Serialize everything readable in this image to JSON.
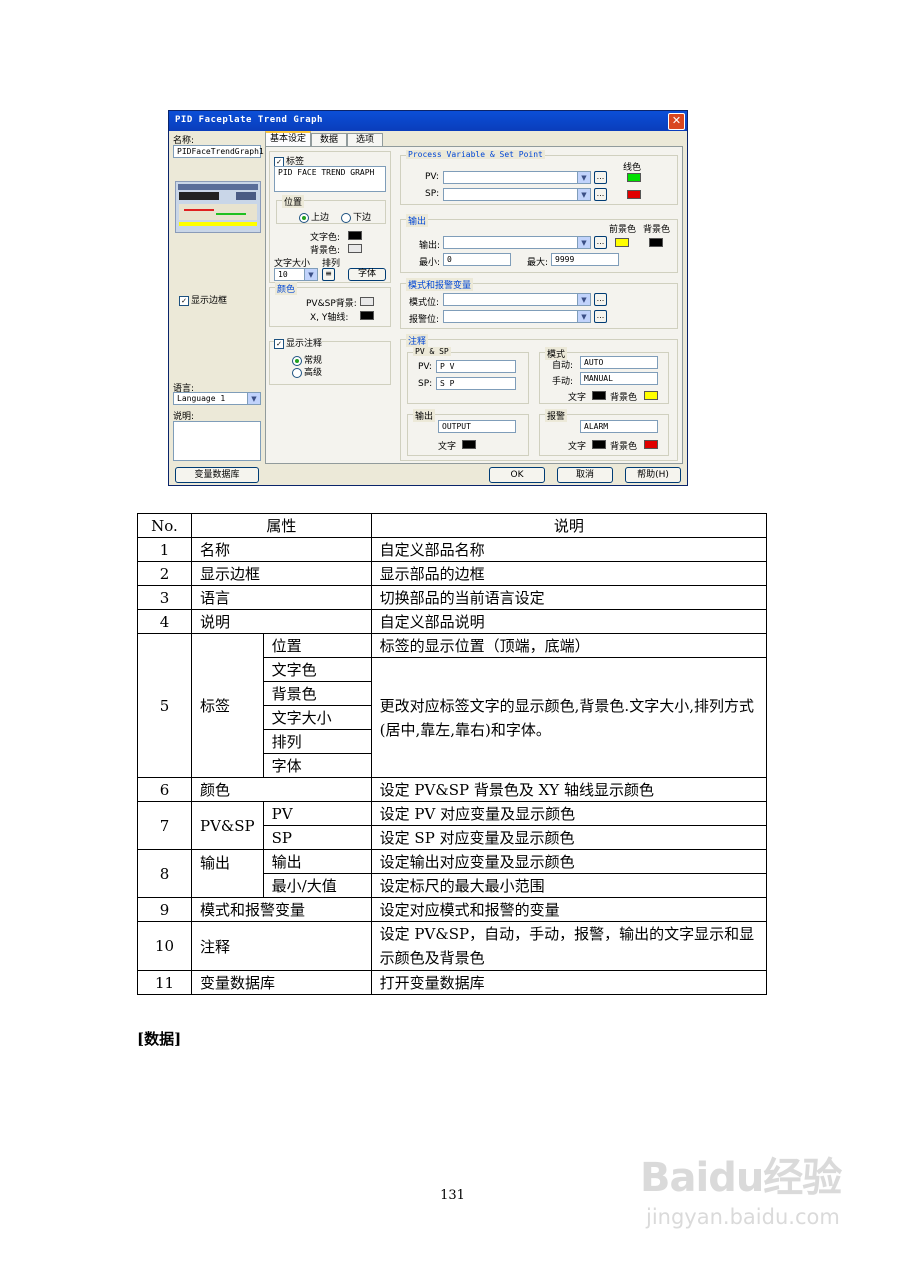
{
  "dialog": {
    "title": "PID Faceplate Trend Graph",
    "close": "✕",
    "name_label": "名称:",
    "name_value": "PIDFaceTrendGraph1",
    "show_border": "显示边框",
    "language_label": "语言:",
    "language_value": "Language 1",
    "desc_label": "说明:",
    "tag_db_button": "变量数据库",
    "ok": "OK",
    "cancel": "取消",
    "help": "帮助(H)",
    "tabs": [
      "基本设定",
      "数据",
      "选项"
    ],
    "label_group": {
      "checkbox": "标签",
      "text": "PID FACE TREND GRAPH",
      "position_title": "位置",
      "top": "上边",
      "bottom": "下边",
      "text_color": "文字色:",
      "bg_color": "背景色:",
      "font_size": "文字大小",
      "align": "排列",
      "font_size_value": "10",
      "font_button": "字体"
    },
    "color_group": {
      "title": "颜色",
      "pvsp_bg": "PV&SP背景:",
      "xy_axis": "X, Y轴线:"
    },
    "notes_checkbox": {
      "label": "显示注释",
      "normal": "常规",
      "advanced": "高级"
    },
    "pvsp_group": {
      "title": "Process Variable & Set Point",
      "line_color": "线色",
      "pv": "PV:",
      "sp": "SP:",
      "dots": "..."
    },
    "output_group": {
      "title": "输出",
      "fg": "前景色",
      "bg": "背景色",
      "output": "输出:",
      "min": "最小:",
      "min_value": "0",
      "max": "最大:",
      "max_value": "9999"
    },
    "mode_group": {
      "title": "模式和报警变量",
      "mode": "模式位:",
      "alarm": "报警位:"
    },
    "note_group": {
      "title": "注释",
      "pvsp_title": "PV & SP",
      "pv": "PV:",
      "pv_value": "P V",
      "sp": "SP:",
      "sp_value": "S P",
      "mode_title": "模式",
      "auto": "自动:",
      "auto_value": "AUTO",
      "manual": "手动:",
      "manual_value": "MANUAL",
      "text": "文字",
      "bgc": "背景色",
      "output_title": "输出",
      "output_value": "OUTPUT",
      "alarm_title": "报警",
      "alarm_value": "ALARM"
    },
    "colors": {
      "green": "#00e000",
      "red": "#e00000",
      "yellow": "#ffff00",
      "black": "#000000"
    }
  },
  "table": {
    "headers": [
      "No.",
      "属性",
      "说明"
    ],
    "rows": {
      "r1": [
        "1",
        "名称",
        "自定义部品名称"
      ],
      "r2": [
        "2",
        "显示边框",
        "显示部品的边框"
      ],
      "r3": [
        "3",
        "语言",
        "切换部品的当前语言设定"
      ],
      "r4": [
        "4",
        "说明",
        "自定义部品说明"
      ],
      "r5": {
        "no": "5",
        "attr": "标签",
        "subs": [
          "位置",
          "文字色",
          "背景色",
          "文字大小",
          "排列",
          "字体"
        ],
        "desc1": "标签的显示位置（顶端，底端）",
        "desc2": "更改对应标签文字的显示颜色,背景色.文字大小,排列方式(居中,靠左,靠右)和字体。"
      },
      "r6": [
        "6",
        "颜色",
        "设定 PV&SP 背景色及 XY 轴线显示颜色"
      ],
      "r7": {
        "no": "7",
        "attr": "PV&SP",
        "sub1": "PV",
        "desc1": "设定 PV 对应变量及显示颜色",
        "sub2": "SP",
        "desc2": "设定 SP 对应变量及显示颜色"
      },
      "r8": {
        "no": "8",
        "attr": "输出",
        "sub1": "输出",
        "desc1": "设定输出对应变量及显示颜色",
        "sub2": "最小/大值",
        "desc2": "设定标尺的最大最小范围"
      },
      "r9": [
        "9",
        "模式和报警变量",
        "设定对应模式和报警的变量"
      ],
      "r10": [
        "10",
        "注释",
        "设定 PV&SP，自动，手动，报警，输出的文字显示和显示颜色及背景色"
      ],
      "r11": [
        "11",
        "变量数据库",
        "打开变量数据库"
      ]
    }
  },
  "section_heading": "[数据]",
  "page_number": "131",
  "watermark": {
    "logo": "Baidu经验",
    "url": "jingyan.baidu.com"
  }
}
